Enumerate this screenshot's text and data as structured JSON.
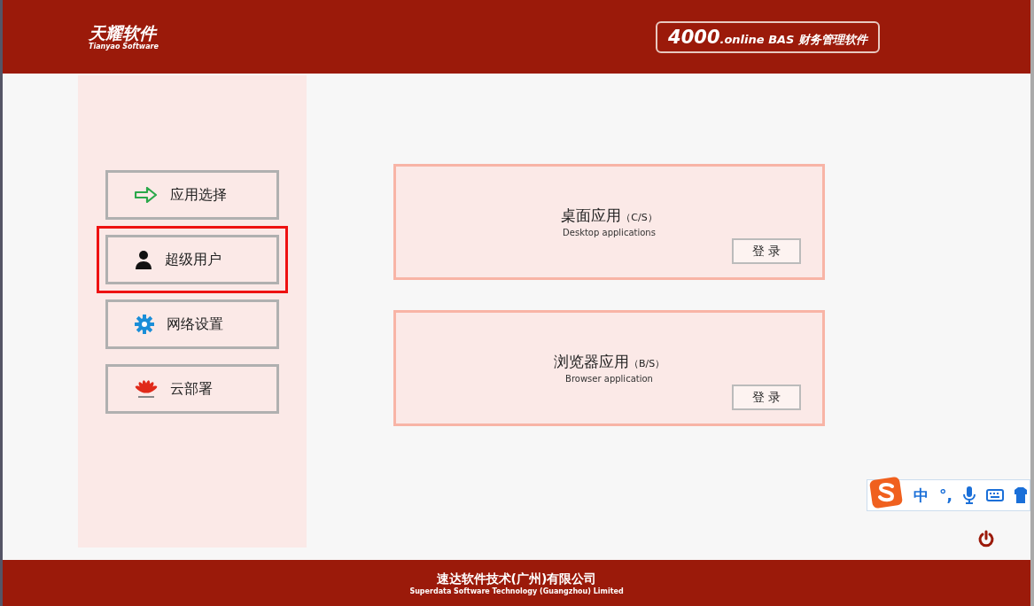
{
  "header": {
    "logo_title": "天耀软件",
    "logo_subtitle": "Tianyao Software",
    "product_number": "4000",
    "product_name": ".online BAS 财务管理软件"
  },
  "sidebar": {
    "items": [
      {
        "label": "应用选择",
        "kind": "arrow",
        "selected": false
      },
      {
        "label": "超级用户",
        "kind": "user",
        "selected": true
      },
      {
        "label": "网络设置",
        "kind": "gear",
        "selected": false
      },
      {
        "label": "云部署",
        "kind": "cloud",
        "selected": false
      }
    ]
  },
  "apps": [
    {
      "title": "桌面应用",
      "tag": "（C/S）",
      "subtitle": "Desktop applications",
      "button": "登 录"
    },
    {
      "title": "浏览器应用",
      "tag": "（B/S）",
      "subtitle": "Browser application",
      "button": "登 录"
    }
  ],
  "ime_toolbar": {
    "mode": "中",
    "punctuation": "°,"
  },
  "footer": {
    "company": "速达软件技术(广州)有限公司",
    "company_en": "Superdata Software Technology (Guangzhou) Limited"
  }
}
